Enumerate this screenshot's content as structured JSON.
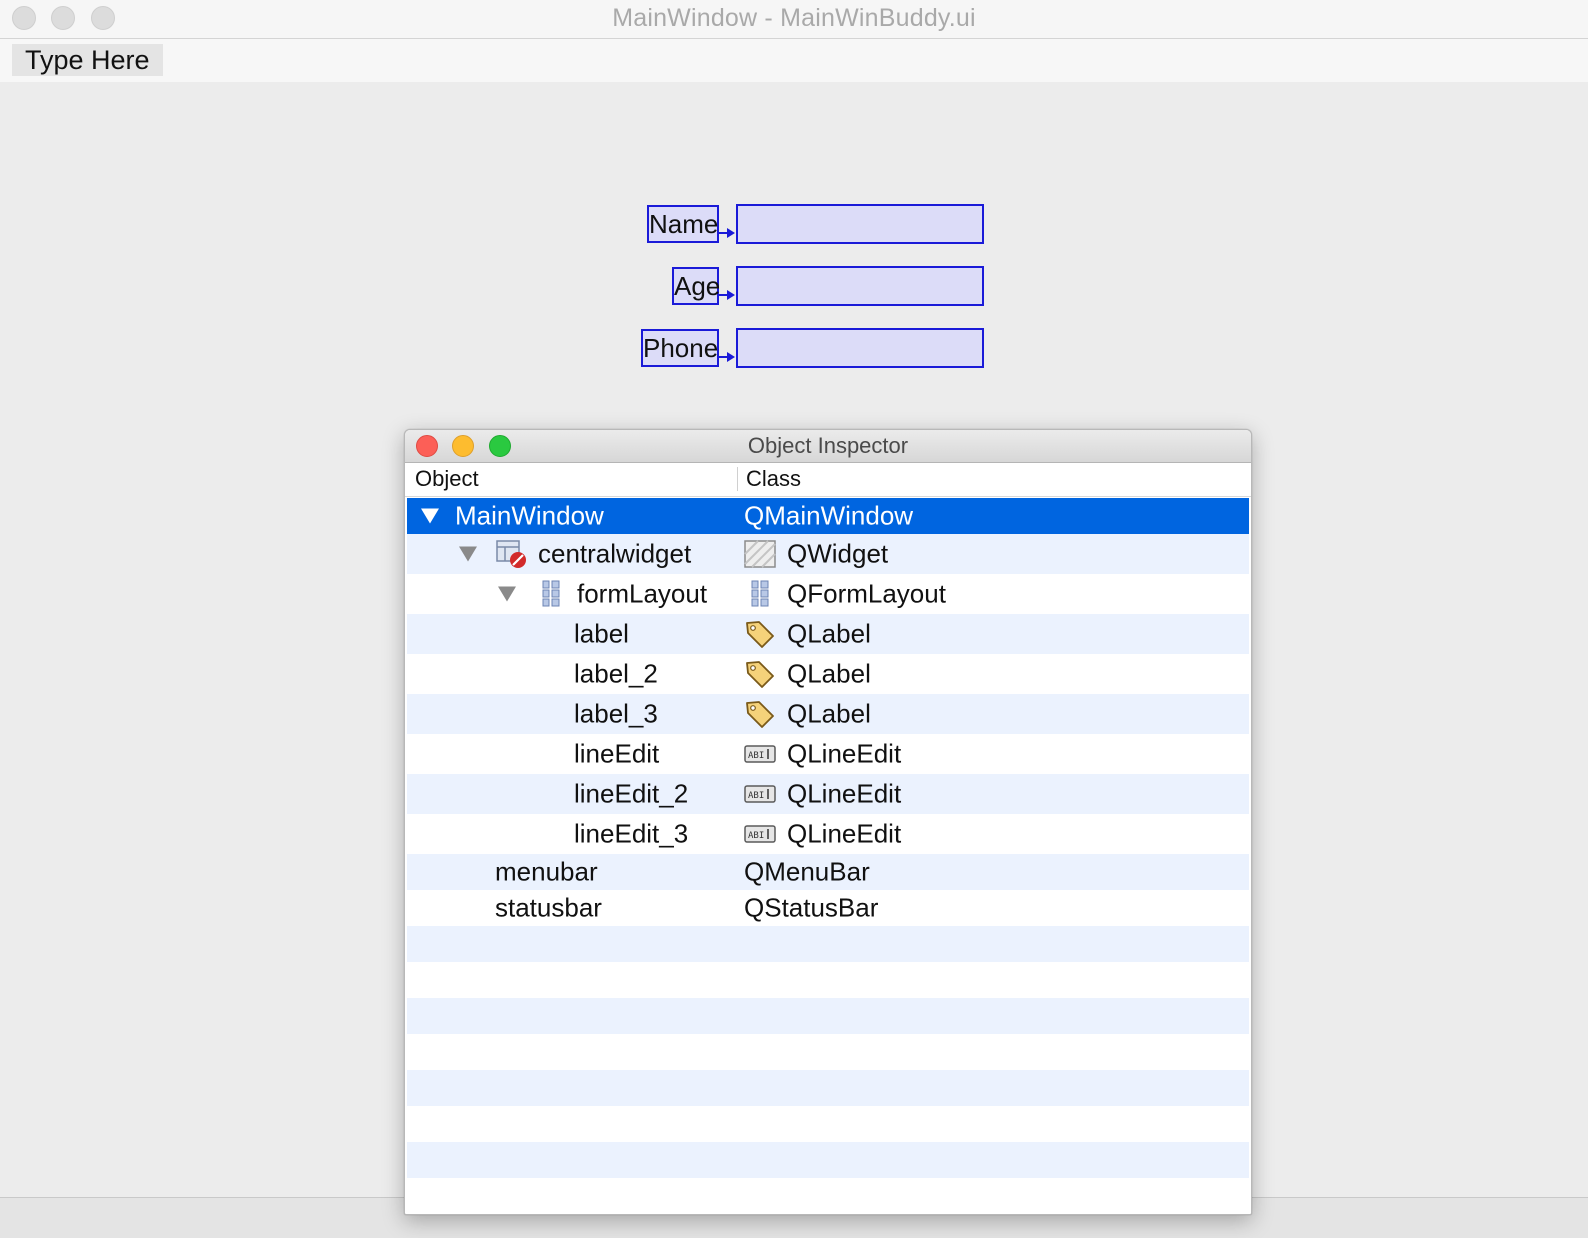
{
  "window": {
    "title": "MainWindow - MainWinBuddy.ui"
  },
  "menubar": {
    "type_here": "Type Here"
  },
  "form": {
    "fields": [
      {
        "label": "Name"
      },
      {
        "label": "Age"
      },
      {
        "label": "Phone"
      }
    ]
  },
  "inspector": {
    "title": "Object Inspector",
    "columns": {
      "object": "Object",
      "class": "Class"
    },
    "rows": [
      {
        "object": "MainWindow",
        "class": "QMainWindow",
        "object_icon": "",
        "class_icon": ""
      },
      {
        "object": "centralwidget",
        "class": "QWidget",
        "object_icon": "widget-broken-icon",
        "class_icon": "widget-hatch-icon"
      },
      {
        "object": "formLayout",
        "class": "QFormLayout",
        "object_icon": "form-layout-icon",
        "class_icon": "form-layout-icon"
      },
      {
        "object": "label",
        "class": "QLabel",
        "object_icon": "",
        "class_icon": "label-tag-icon"
      },
      {
        "object": "label_2",
        "class": "QLabel",
        "object_icon": "",
        "class_icon": "label-tag-icon"
      },
      {
        "object": "label_3",
        "class": "QLabel",
        "object_icon": "",
        "class_icon": "label-tag-icon"
      },
      {
        "object": "lineEdit",
        "class": "QLineEdit",
        "object_icon": "",
        "class_icon": "line-edit-icon"
      },
      {
        "object": "lineEdit_2",
        "class": "QLineEdit",
        "object_icon": "",
        "class_icon": "line-edit-icon"
      },
      {
        "object": "lineEdit_3",
        "class": "QLineEdit",
        "object_icon": "",
        "class_icon": "line-edit-icon"
      },
      {
        "object": "menubar",
        "class": "QMenuBar",
        "object_icon": "",
        "class_icon": ""
      },
      {
        "object": "statusbar",
        "class": "QStatusBar",
        "object_icon": "",
        "class_icon": ""
      }
    ],
    "selected_row": "MainWindow",
    "colors": {
      "selection": "#0065e0",
      "alt_row": "#ebf2fe",
      "buddy": "#1a1ad8"
    }
  }
}
